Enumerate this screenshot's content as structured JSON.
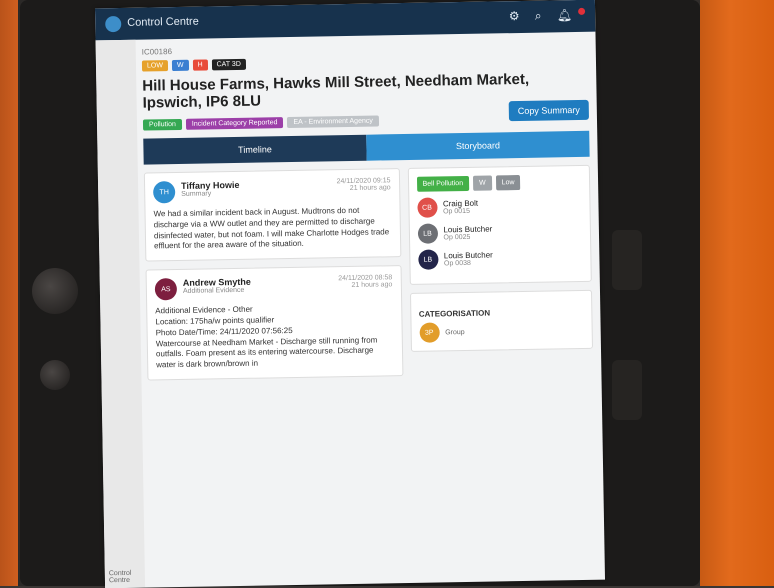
{
  "app": {
    "title": "Control Centre",
    "sidebar_caption": "Control Centre"
  },
  "topbar": {
    "icons": [
      "settings-icon",
      "search-icon",
      "bell-icon"
    ]
  },
  "incident": {
    "reference": "IC00186",
    "chips": [
      {
        "label": "LOW",
        "color": "#e6a12b"
      },
      {
        "label": "W",
        "color": "#3b7fd1"
      },
      {
        "label": "H",
        "color": "#e84b3a"
      },
      {
        "label": "CAT 3D",
        "color": "#222222"
      }
    ],
    "address": "Hill House Farms, Hawks Mill Street, Needham Market, Ipswich, IP6 8LU",
    "tags": [
      {
        "label": "Pollution",
        "color": "#35a853"
      },
      {
        "label": "Incident Category Reported",
        "color": "#9c3fa8"
      },
      {
        "label": "EA - Environment Agency",
        "color": "#bfc3c7"
      }
    ],
    "copy_summary": "Copy Summary"
  },
  "tabs": [
    {
      "label": "Timeline",
      "color": "#1e3a58"
    },
    {
      "label": "Storyboard",
      "color": "#2f8fd0"
    }
  ],
  "timeline": [
    {
      "initials": "TH",
      "avatar_color": "#2f8fd0",
      "name": "Tiffany Howie",
      "role": "Summary",
      "meta_time": "24/11/2020 09:15",
      "meta_ago": "21 hours ago",
      "body": "We had a similar incident back in August. Mudtrons do not discharge via a WW outlet and they are permitted to discharge disinfected water, but not foam. I will make Charlotte Hodges trade effluent for the area aware of the situation."
    },
    {
      "initials": "AS",
      "avatar_color": "#7d1f3f",
      "name": "Andrew Smythe",
      "role": "Additional Evidence",
      "meta_time": "24/11/2020 08:58",
      "meta_ago": "21 hours ago",
      "body": "Additional Evidence - Other\nLocation: 175ha/w points qualifier\nPhoto Date/Time: 24/11/2020 07:56:25\nWatercourse at Needham Market - Discharge still running from outfalls. Foam present as its entering watercourse. Discharge water is dark brown/brown in"
    }
  ],
  "storyboard": {
    "chips": [
      {
        "label": "Bell Pollution",
        "color": "#43b047"
      },
      {
        "label": "W",
        "color": "#9fa4a8"
      },
      {
        "label": "Low",
        "color": "#8a8f94"
      }
    ],
    "people": [
      {
        "initials": "CB",
        "color": "#e0504a",
        "name": "Craig Bolt",
        "sub": "Op 0015"
      },
      {
        "initials": "LB",
        "color": "#6d6f74",
        "name": "Louis Butcher",
        "sub": "Op 0025"
      },
      {
        "initials": "LB",
        "color": "#23254a",
        "name": "Louis Butcher",
        "sub": "Op 0038"
      }
    ],
    "categorisation_title": "CATEGORISATION",
    "category": {
      "badge": "3P",
      "text": "Group"
    }
  }
}
